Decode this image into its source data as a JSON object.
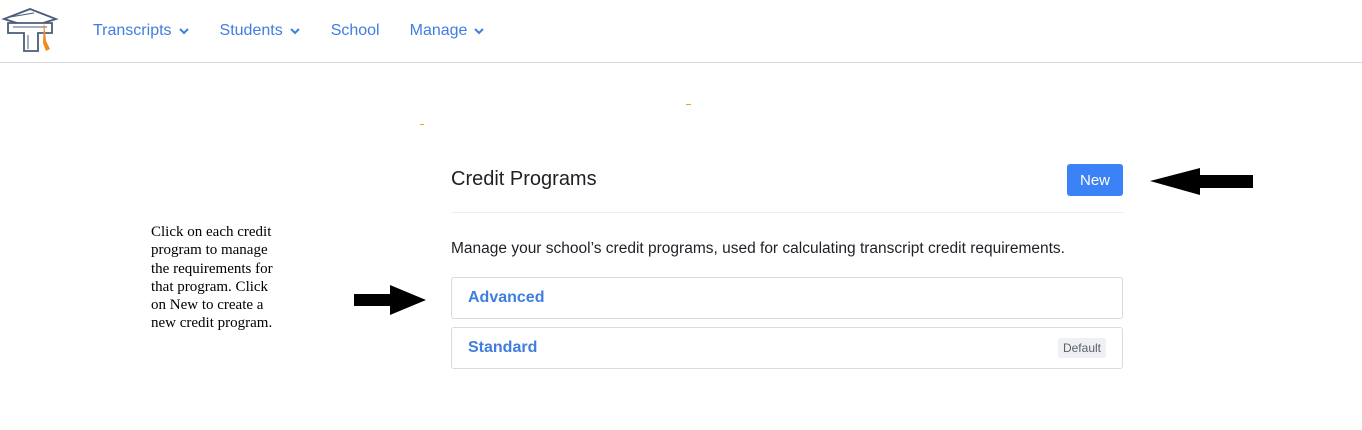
{
  "nav": {
    "logo_name": "graduation-cap-T-logo",
    "items": [
      {
        "label": "Transcripts",
        "has_dropdown": true
      },
      {
        "label": "Students",
        "has_dropdown": true
      },
      {
        "label": "School",
        "has_dropdown": false
      },
      {
        "label": "Manage",
        "has_dropdown": true
      }
    ],
    "link_color": "#3f7ee0"
  },
  "annotation": {
    "text": "Click on each credit\nprogram to manage\nthe requirements for\nthat program. Click\non New to create a\nnew credit program."
  },
  "panel": {
    "title": "Credit Programs",
    "new_button_label": "New",
    "new_button_color": "#3b82f6",
    "description": "Manage your school’s credit programs, used for calculating transcript credit requirements.",
    "programs": [
      {
        "name": "Advanced",
        "badge": ""
      },
      {
        "name": "Standard",
        "badge": "Default"
      }
    ]
  }
}
